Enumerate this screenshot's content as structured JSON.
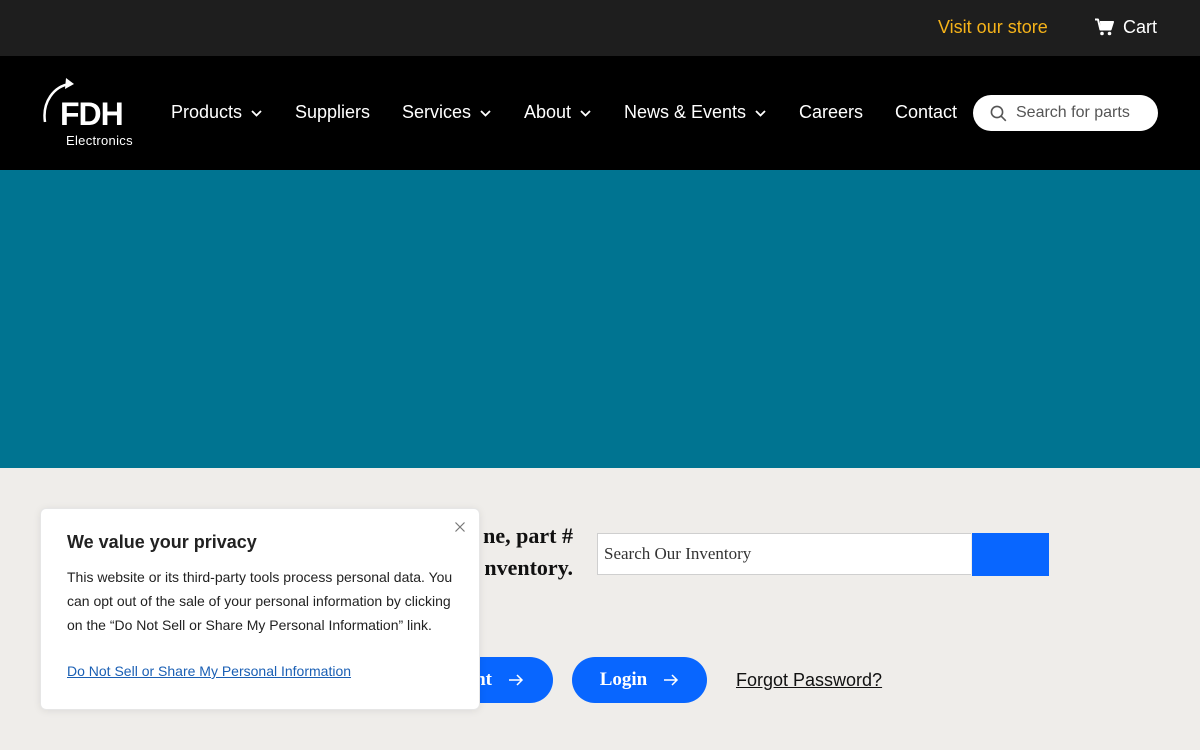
{
  "topbar": {
    "store_link": "Visit our store",
    "cart_label": "Cart",
    "store_link_color": "#f6b319"
  },
  "logo": {
    "brand": "FDH",
    "subtitle": "Electronics"
  },
  "nav": {
    "items": [
      {
        "label": "Products",
        "has_dropdown": true
      },
      {
        "label": "Suppliers",
        "has_dropdown": false
      },
      {
        "label": "Services",
        "has_dropdown": true
      },
      {
        "label": "About",
        "has_dropdown": true
      },
      {
        "label": "News & Events",
        "has_dropdown": true
      },
      {
        "label": "Careers",
        "has_dropdown": false
      },
      {
        "label": "Contact",
        "has_dropdown": false
      }
    ],
    "search_placeholder": "Search for parts"
  },
  "hero": {
    "color": "#007491"
  },
  "inventory": {
    "prompt_line1": "ne, part #",
    "prompt_line2": "nventory.",
    "search_placeholder": "Search Our Inventory",
    "button_color": "#0866ff"
  },
  "account": {
    "create_label_visible": "nt",
    "login_label": "Login",
    "forgot_label": "Forgot Password?"
  },
  "consent": {
    "title": "We value your privacy",
    "body": "This website or its third-party tools process personal data. You can opt out of the sale of your personal information by clicking on the “Do Not Sell or Share My Personal Information” link.",
    "link": "Do Not Sell or Share My Personal Information"
  }
}
